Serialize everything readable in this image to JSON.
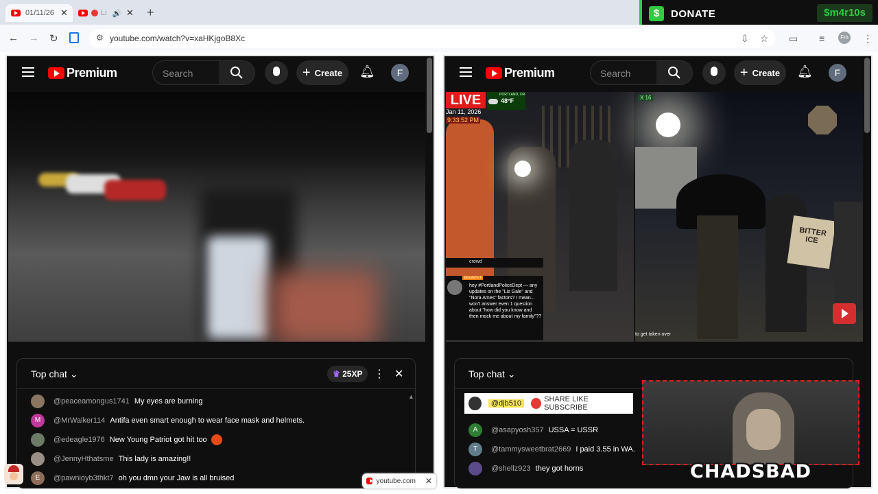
{
  "browser": {
    "tabs": [
      {
        "title": "01/11/26"
      },
      {
        "title": "Li"
      }
    ],
    "new_tab": "+",
    "url": "youtube.com/watch?v=xaHKjgoB8Xc",
    "profile": "Fm"
  },
  "donate": {
    "label": "DONATE",
    "icon": "$",
    "cashtag": "$m4r10s"
  },
  "left_pane": {
    "logo": "Premium",
    "search_placeholder": "Search",
    "create_label": "Create",
    "avatar": "F",
    "chat": {
      "title": "Top chat",
      "xp": "25XP",
      "messages": [
        {
          "avatar": "",
          "author": "@peaceamongus1741",
          "text": "My eyes are burning",
          "color": "#8a7560"
        },
        {
          "avatar": "M",
          "author": "@MrWalker114",
          "text": "Antifa even smart enough to wear face mask and helmets.",
          "color": "#c0399a"
        },
        {
          "avatar": "",
          "author": "@edeagle1976",
          "text": "New Young Patriot got hit too",
          "color": "#6d7a66"
        },
        {
          "avatar": "",
          "author": "@JennyHthatsme",
          "text": "This lady is amazing!!",
          "color": "#9a8f86"
        },
        {
          "avatar": "E",
          "author": "@pawnioyb3thkt7",
          "text": "oh you dmn your Jaw is all bruised",
          "color": "#8e6d5a"
        }
      ]
    },
    "popup": "youtube.com"
  },
  "right_pane": {
    "logo": "Premium",
    "search_placeholder": "Search",
    "create_label": "Create",
    "avatar": "F",
    "stream": {
      "live": "LIVE",
      "date": "Jan 11, 2026",
      "time": "9:33:52 PM",
      "temp": "48°F",
      "location": "PORTLAND, OR",
      "caption_top": "crowd",
      "comment_handle": "@muttchick",
      "comment": "hey #PortlandPoliceDept — any updates on the \"Liz Gale\" and \"Nora Ames\" factors? I mean... won't answer even 1 question about \"how did you know and then mock me about my family\"??",
      "right_badge": "X 16",
      "right_caption": "to get taken over",
      "sign": "BITTER ICE"
    },
    "chat": {
      "title": "Top chat",
      "pinned_author": "@djb510",
      "pinned_text": "SHARE LIKE SUBSCRIBE",
      "messages": [
        {
          "avatar": "A",
          "author": "@asapyosh357",
          "text": "USSA = USSR",
          "color": "#2e7d32"
        },
        {
          "avatar": "T",
          "author": "@tammysweetbrat2669",
          "text": "I paid 3.55 in WA.",
          "color": "#607d8b"
        },
        {
          "avatar": "",
          "author": "@shellz923",
          "text": "they got horns",
          "color": "#5c4b8a"
        }
      ]
    }
  },
  "overlay": {
    "streamer": "CHADSBAD"
  }
}
